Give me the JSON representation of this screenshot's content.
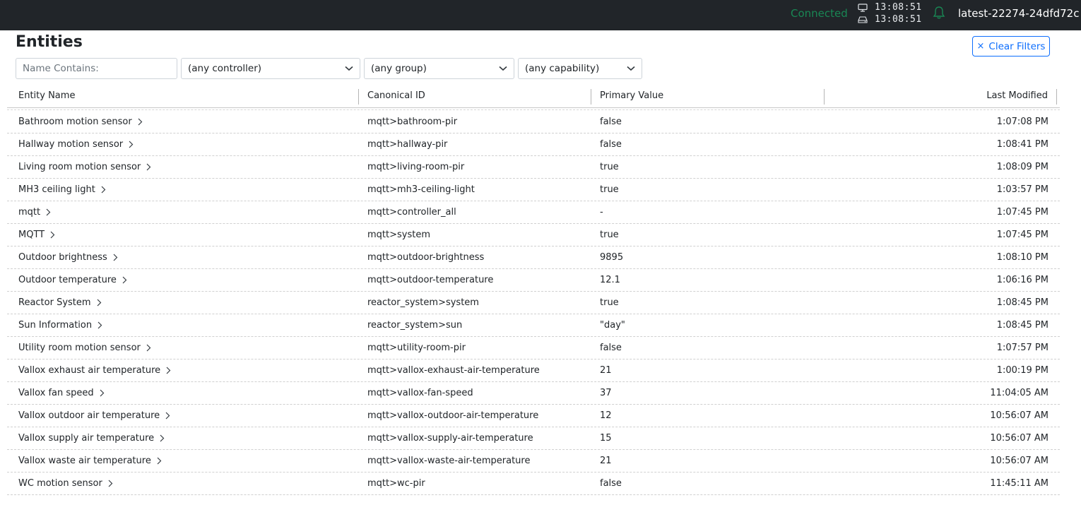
{
  "topbar": {
    "status": "Connected",
    "client_time": "13:08:51",
    "server_time": "13:08:51",
    "client_icon": "monitor-icon",
    "server_icon": "server-icon",
    "bell_icon": "bell-icon",
    "build": "latest-22274-24dfd72c"
  },
  "page": {
    "title": "Entities"
  },
  "filters": {
    "name_placeholder": "Name Contains:",
    "controller": "(any controller)",
    "group": "(any group)",
    "capability": "(any capability)",
    "clear_label": "Clear Filters"
  },
  "table": {
    "headers": [
      "Entity Name",
      "Canonical ID",
      "Primary Value",
      "Last Modified"
    ],
    "rows": [
      {
        "name": "Bathroom motion sensor",
        "id": "mqtt>bathroom-pir",
        "value": "false",
        "modified": "1:07:08 PM"
      },
      {
        "name": "Hallway motion sensor",
        "id": "mqtt>hallway-pir",
        "value": "false",
        "modified": "1:08:41 PM"
      },
      {
        "name": "Living room motion sensor",
        "id": "mqtt>living-room-pir",
        "value": "true",
        "modified": "1:08:09 PM"
      },
      {
        "name": "MH3 ceiling light",
        "id": "mqtt>mh3-ceiling-light",
        "value": "true",
        "modified": "1:03:57 PM"
      },
      {
        "name": "mqtt",
        "id": "mqtt>controller_all",
        "value": "-",
        "modified": "1:07:45 PM"
      },
      {
        "name": "MQTT",
        "id": "mqtt>system",
        "value": "true",
        "modified": "1:07:45 PM"
      },
      {
        "name": "Outdoor brightness",
        "id": "mqtt>outdoor-brightness",
        "value": "9895",
        "modified": "1:08:10 PM"
      },
      {
        "name": "Outdoor temperature",
        "id": "mqtt>outdoor-temperature",
        "value": "12.1",
        "modified": "1:06:16 PM"
      },
      {
        "name": "Reactor System",
        "id": "reactor_system>system",
        "value": "true",
        "modified": "1:08:45 PM"
      },
      {
        "name": "Sun Information",
        "id": "reactor_system>sun",
        "value": "\"day\"",
        "modified": "1:08:45 PM"
      },
      {
        "name": "Utility room motion sensor",
        "id": "mqtt>utility-room-pir",
        "value": "false",
        "modified": "1:07:57 PM"
      },
      {
        "name": "Vallox exhaust air temperature",
        "id": "mqtt>vallox-exhaust-air-temperature",
        "value": "21",
        "modified": "1:00:19 PM"
      },
      {
        "name": "Vallox fan speed",
        "id": "mqtt>vallox-fan-speed",
        "value": "37",
        "modified": "11:04:05 AM"
      },
      {
        "name": "Vallox outdoor air temperature",
        "id": "mqtt>vallox-outdoor-air-temperature",
        "value": "12",
        "modified": "10:56:07 AM"
      },
      {
        "name": "Vallox supply air temperature",
        "id": "mqtt>vallox-supply-air-temperature",
        "value": "15",
        "modified": "10:56:07 AM"
      },
      {
        "name": "Vallox waste air temperature",
        "id": "mqtt>vallox-waste-air-temperature",
        "value": "21",
        "modified": "10:56:07 AM"
      },
      {
        "name": "WC motion sensor",
        "id": "mqtt>wc-pir",
        "value": "false",
        "modified": "11:45:11 AM"
      }
    ]
  }
}
